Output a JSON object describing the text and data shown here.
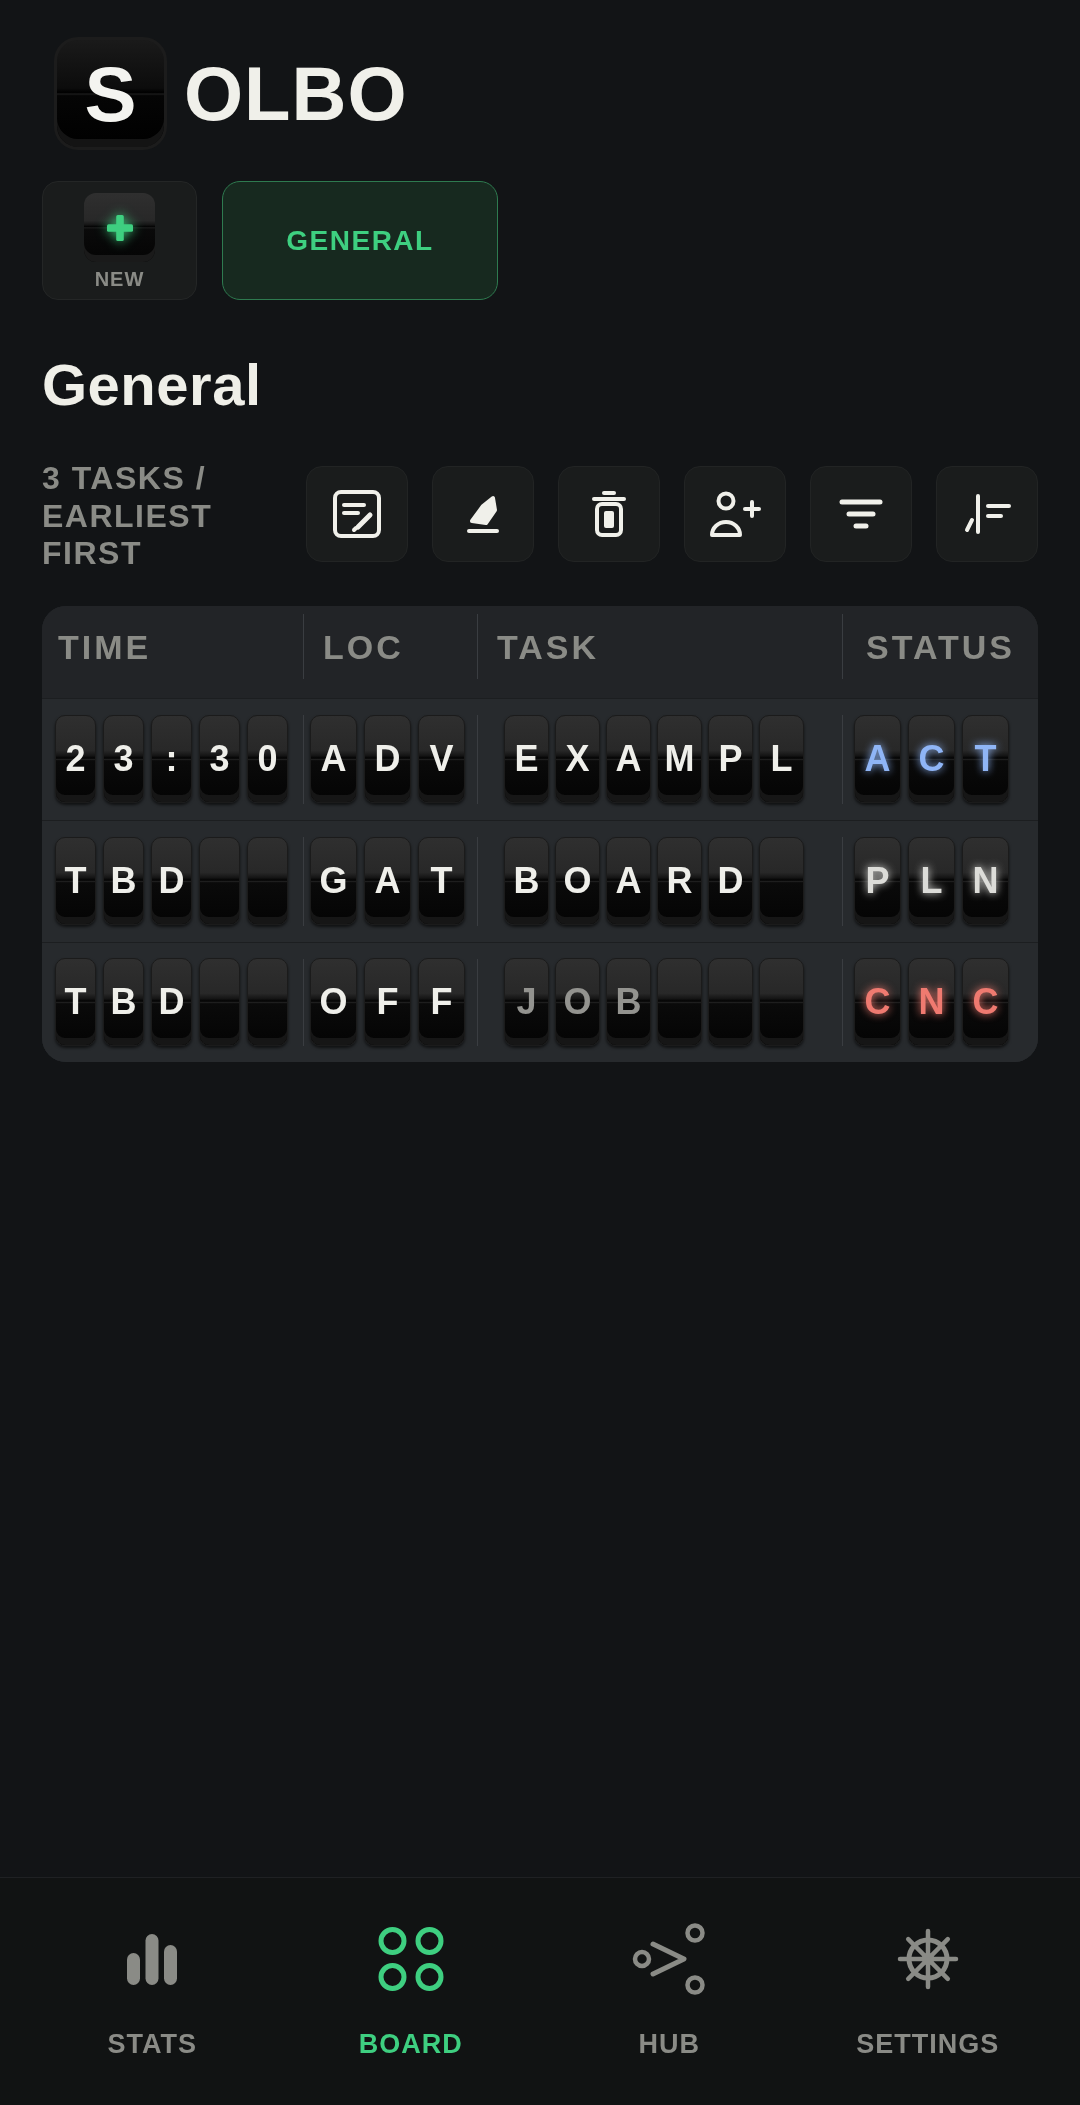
{
  "logo": {
    "tile_letter": "S",
    "text": "OLBO"
  },
  "new_button": {
    "label": "NEW"
  },
  "tabs": [
    {
      "label": "GENERAL",
      "selected": true
    }
  ],
  "board": {
    "title": "General",
    "summary": "3 TASKS / EARLIEST FIRST"
  },
  "table": {
    "columns": [
      "TIME",
      "LOC",
      "TASK",
      "STATUS"
    ],
    "rows": [
      {
        "time": [
          "2",
          "3",
          ":",
          "3",
          "0"
        ],
        "loc": [
          "A",
          "D",
          "V"
        ],
        "task": {
          "letters": [
            "E",
            "X",
            "A",
            "M",
            "P",
            "L"
          ],
          "dimmed": false
        },
        "status": {
          "letters": [
            "A",
            "C",
            "T"
          ],
          "color": "#8fb5f6"
        }
      },
      {
        "time": [
          "T",
          "B",
          "D"
        ],
        "loc": [
          "G",
          "A",
          "T"
        ],
        "task": {
          "letters": [
            "B",
            "O",
            "A",
            "R",
            "D"
          ],
          "dimmed": false
        },
        "status": {
          "letters": [
            "P",
            "L",
            "N"
          ],
          "color": "#dcdcd8"
        }
      },
      {
        "time": [
          "T",
          "B",
          "D"
        ],
        "loc": [
          "O",
          "F",
          "F"
        ],
        "task": {
          "letters": [
            "J",
            "O",
            "B"
          ],
          "dimmed": true
        },
        "status": {
          "letters": [
            "C",
            "N",
            "C"
          ],
          "color": "#ef7a70"
        }
      }
    ]
  },
  "nav": {
    "items": [
      {
        "label": "STATS",
        "selected": false
      },
      {
        "label": "BOARD",
        "selected": true
      },
      {
        "label": "HUB",
        "selected": false
      },
      {
        "label": "SETTINGS",
        "selected": false
      }
    ]
  }
}
